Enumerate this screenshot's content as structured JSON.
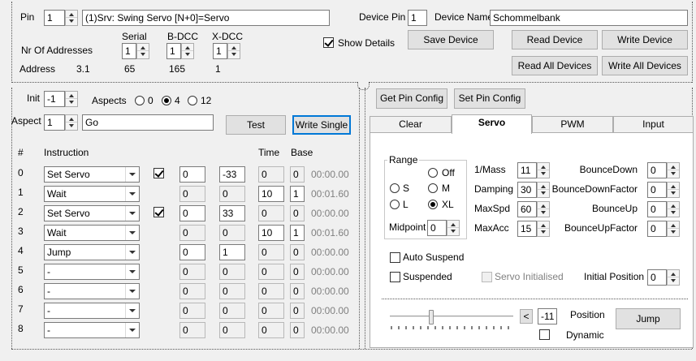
{
  "header": {
    "pin_label": "Pin",
    "pin_value": "1",
    "pin_desc": "(1)Srv: Swing Servo [N+0]=Servo",
    "device_pin_label": "Device Pin",
    "device_pin_value": "1",
    "device_name_label": "Device Name",
    "device_name_value": "Schommelbank",
    "nr_addresses_label": "Nr Of Addresses",
    "serial_label": "Serial",
    "bdcc_label": "B-DCC",
    "xdcc_label": "X-DCC",
    "serial_count": "1",
    "bdcc_count": "1",
    "xdcc_count": "1",
    "address_label": "Address",
    "address_value": "3.1",
    "serial_address": "65",
    "bdcc_address": "165",
    "xdcc_address": "1",
    "show_details_label": "Show Details"
  },
  "buttons": {
    "save_device": "Save Device",
    "read_device": "Read Device",
    "write_device": "Write Device",
    "read_all": "Read All Devices",
    "write_all": "Write All Devices",
    "test": "Test",
    "write_single": "Write Single",
    "get_pin_config": "Get Pin Config",
    "set_pin_config": "Set Pin Config",
    "jump": "Jump"
  },
  "left": {
    "init_label": "Init",
    "init_value": "-1",
    "aspects_label": "Aspects",
    "aspect_opts": [
      "0",
      "4",
      "12"
    ],
    "aspect_label": "Aspect",
    "aspect_value": "1",
    "aspect_name": "Go",
    "col_hash": "#",
    "col_instruction": "Instruction",
    "col_time": "Time",
    "col_base": "Base",
    "rows": [
      {
        "idx": "0",
        "instr": "Set Servo",
        "c1": "0",
        "c2": "-33",
        "time": "0",
        "base": "0",
        "elapsed": "00:00.00"
      },
      {
        "idx": "1",
        "instr": "Wait",
        "c1": "0",
        "c2": "0",
        "time": "10",
        "base": "1",
        "elapsed": "00:01.60"
      },
      {
        "idx": "2",
        "instr": "Set Servo",
        "c1": "0",
        "c2": "33",
        "time": "0",
        "base": "0",
        "elapsed": "00:00.00"
      },
      {
        "idx": "3",
        "instr": "Wait",
        "c1": "0",
        "c2": "0",
        "time": "10",
        "base": "1",
        "elapsed": "00:01.60"
      },
      {
        "idx": "4",
        "instr": "Jump",
        "c1": "0",
        "c2": "1",
        "time": "0",
        "base": "0",
        "elapsed": "00:00.00"
      },
      {
        "idx": "5",
        "instr": "-",
        "c1": "0",
        "c2": "0",
        "time": "0",
        "base": "0",
        "elapsed": "00:00.00"
      },
      {
        "idx": "6",
        "instr": "-",
        "c1": "0",
        "c2": "0",
        "time": "0",
        "base": "0",
        "elapsed": "00:00.00"
      },
      {
        "idx": "7",
        "instr": "-",
        "c1": "0",
        "c2": "0",
        "time": "0",
        "base": "0",
        "elapsed": "00:00.00"
      },
      {
        "idx": "8",
        "instr": "-",
        "c1": "0",
        "c2": "0",
        "time": "0",
        "base": "0",
        "elapsed": "00:00.00"
      }
    ]
  },
  "tabs": [
    "Clear",
    "Servo",
    "PWM",
    "Input"
  ],
  "servo": {
    "range_label": "Range",
    "range_opts": [
      "Off",
      "S",
      "M",
      "L",
      "XL"
    ],
    "midpoint_label": "Midpoint",
    "midpoint_value": "0",
    "params_left": [
      {
        "label": "1/Mass",
        "value": "11"
      },
      {
        "label": "Damping",
        "value": "30"
      },
      {
        "label": "MaxSpd",
        "value": "60"
      },
      {
        "label": "MaxAcc",
        "value": "15"
      }
    ],
    "params_right": [
      {
        "label": "BounceDown",
        "value": "0"
      },
      {
        "label": "BounceDownFactor",
        "value": "0"
      },
      {
        "label": "BounceUp",
        "value": "0"
      },
      {
        "label": "BounceUpFactor",
        "value": "0"
      }
    ],
    "auto_suspend_label": "Auto Suspend",
    "suspended_label": "Suspended",
    "servo_initialised_label": "Servo Initialised",
    "initial_position_label": "Initial Position",
    "initial_position_value": "0",
    "position_btn": "<",
    "position_value": "-11",
    "position_label": "Position",
    "dynamic_label": "Dynamic",
    "slider_level": 0.33
  }
}
